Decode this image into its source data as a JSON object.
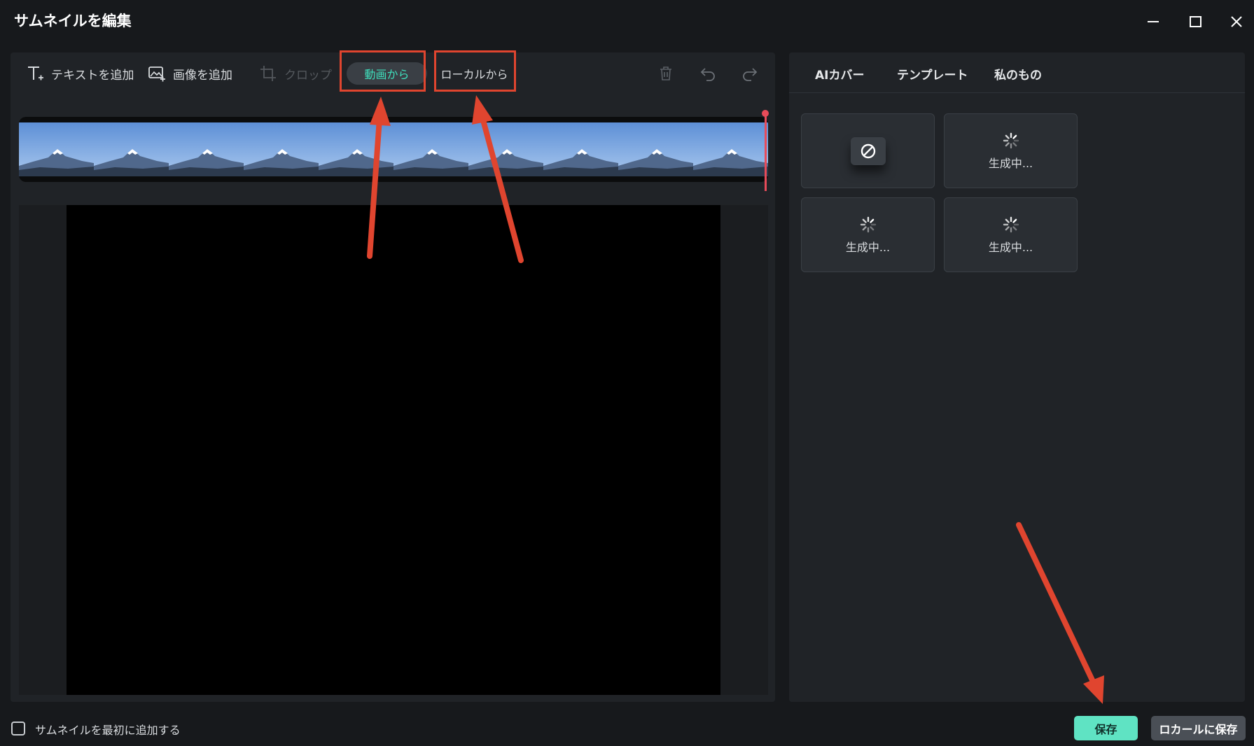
{
  "window": {
    "title": "サムネイルを編集"
  },
  "toolbar": {
    "add_text_label": "テキストを追加",
    "add_image_label": "画像を追加",
    "crop_label": "クロップ",
    "from_video_label": "動画から",
    "from_local_label": "ローカルから"
  },
  "right_panel": {
    "tabs": [
      "AIカバー",
      "テンプレート",
      "私のもの"
    ],
    "cards": [
      {
        "type": "none",
        "label": ""
      },
      {
        "type": "loading",
        "label": "生成中..."
      },
      {
        "type": "loading",
        "label": "生成中..."
      },
      {
        "type": "loading",
        "label": "生成中..."
      }
    ]
  },
  "footer": {
    "checkbox_label": "サムネイルを最初に追加する",
    "checkbox_checked": false,
    "save_label": "保存",
    "save_local_label": "ロカールに保存"
  },
  "colors": {
    "accent": "#3fe0bd",
    "save_button": "#5fe3c3",
    "annotation": "#e0452f",
    "playhead": "#e84b59"
  },
  "filmstrip": {
    "frame_count": 10
  }
}
